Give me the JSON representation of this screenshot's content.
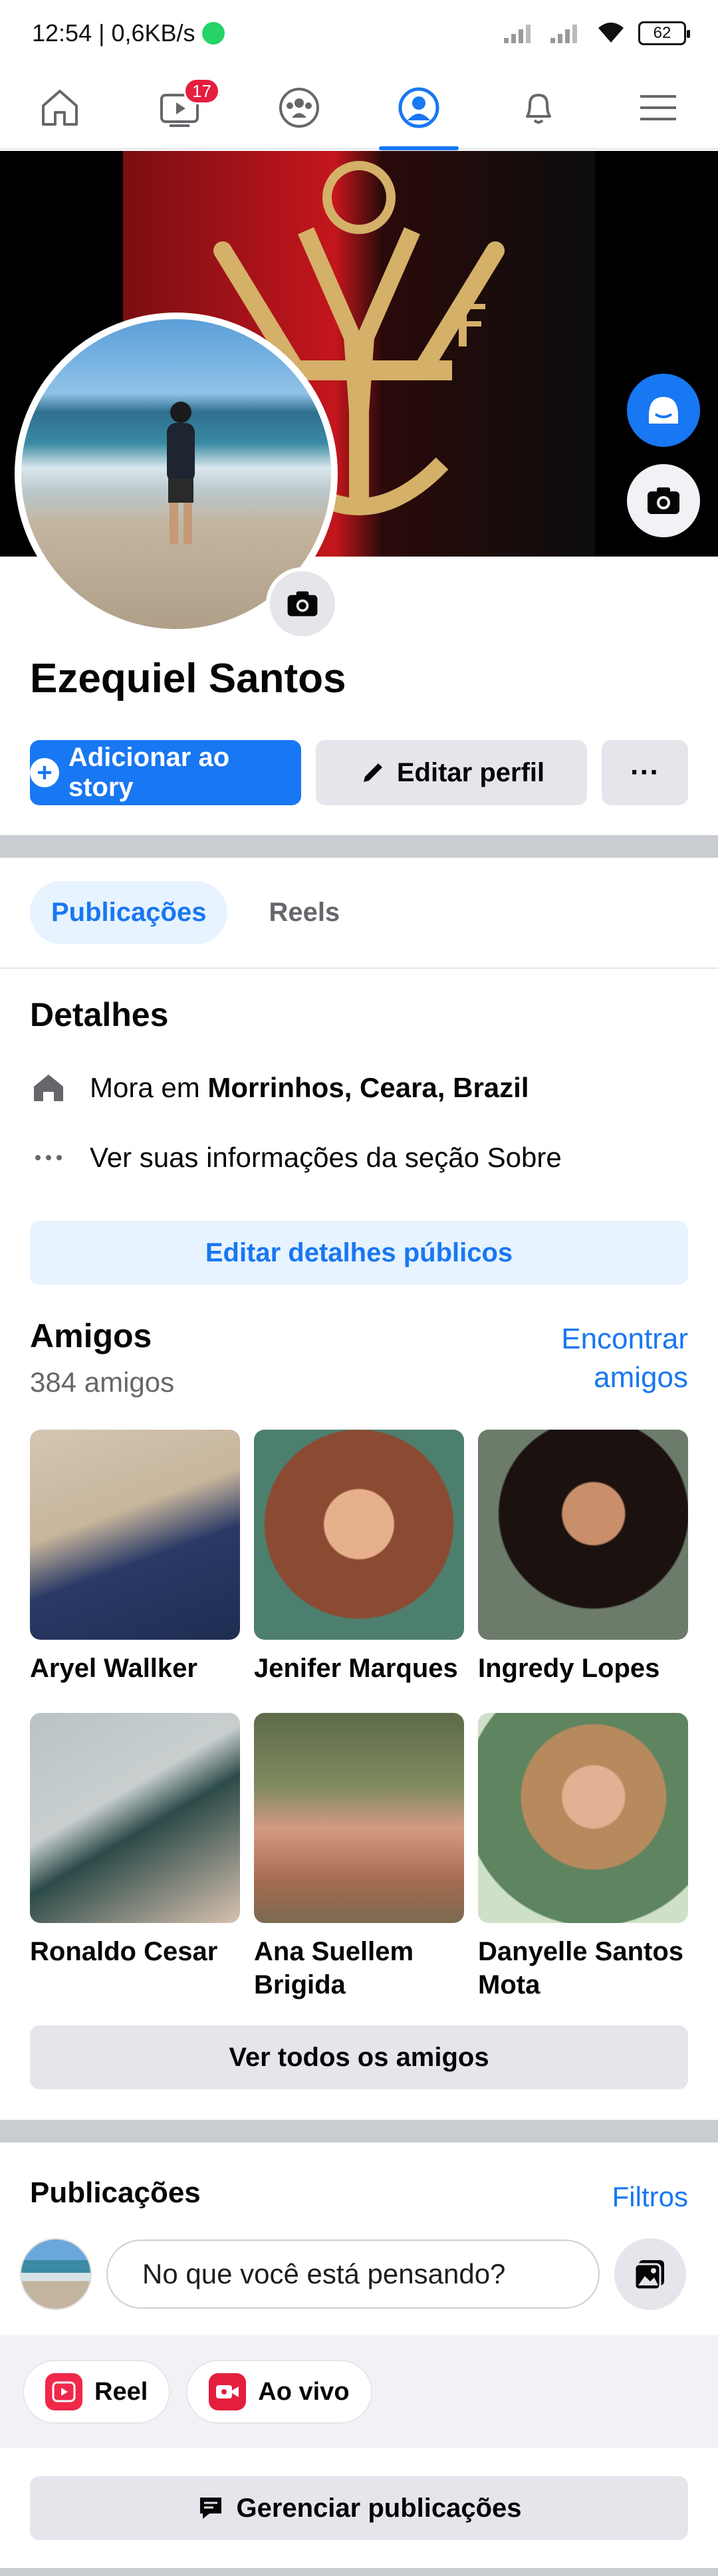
{
  "status_bar": {
    "time": "12:54",
    "speed": "0,6KB/s",
    "battery": "62"
  },
  "nav": {
    "video_badge": "17"
  },
  "profile": {
    "name": "Ezequiel Santos"
  },
  "actions": {
    "add_story": "Adicionar ao story",
    "edit_profile": "Editar perfil",
    "more": "···"
  },
  "tabs": [
    {
      "label": "Publicações"
    },
    {
      "label": "Reels"
    }
  ],
  "details": {
    "title": "Detalhes",
    "lives_prefix": "Mora em ",
    "lives_place": "Morrinhos, Ceara, Brazil",
    "about": "Ver suas informações da seção Sobre",
    "edit_button": "Editar detalhes públicos"
  },
  "friends": {
    "title": "Amigos",
    "count": "384 amigos",
    "find_link_line1": "Encontrar",
    "find_link_line2": "amigos",
    "list": [
      {
        "name": "Aryel Wallker"
      },
      {
        "name": "Jenifer Marques"
      },
      {
        "name": "Ingredy Lopes"
      },
      {
        "name": "Ronaldo Cesar"
      },
      {
        "name": "Ana Suellem Brigida"
      },
      {
        "name": "Danyelle Santos Mota"
      }
    ],
    "see_all": "Ver todos os amigos"
  },
  "posts": {
    "title": "Publicações",
    "filters": "Filtros",
    "composer_placeholder": "No que você está pensando?",
    "reel": "Reel",
    "live": "Ao vivo",
    "manage": "Gerenciar publicações"
  },
  "colors": {
    "accent": "#1877f2",
    "light_accent": "#e7f3ff",
    "gray_button": "#e4e6eb"
  }
}
